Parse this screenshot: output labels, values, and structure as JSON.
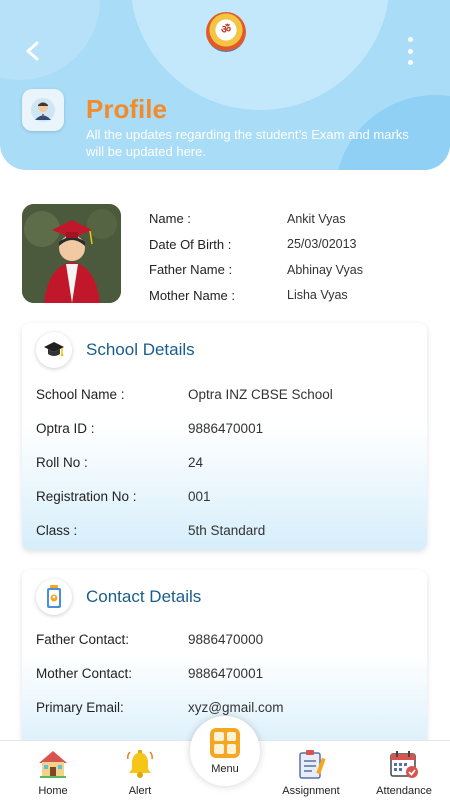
{
  "header": {
    "title": "Profile",
    "subtitle": "All the updates regarding the student’s Exam and marks will be updated here.",
    "logo_text": "ॐ",
    "back_icon": "back-arrow-icon",
    "menu_icon": "more-vertical-icon"
  },
  "student": {
    "labels": {
      "name": "Name :",
      "dob": "Date Of Birth :",
      "father": "Father Name :",
      "mother": "Mother Name :"
    },
    "values": {
      "name": "Ankit Vyas",
      "dob": "25/03/02013",
      "father": "Abhinay Vyas",
      "mother": "Lisha Vyas"
    }
  },
  "school": {
    "title": "School Details",
    "rows": [
      {
        "label": "School Name :",
        "value": "Optra INZ CBSE School"
      },
      {
        "label": "Optra ID :",
        "value": "9886470001"
      },
      {
        "label": "Roll No :",
        "value": "24"
      },
      {
        "label": "Registration No :",
        "value": "001"
      },
      {
        "label": "Class :",
        "value": "5th Standard"
      }
    ]
  },
  "contact": {
    "title": "Contact Details",
    "rows": [
      {
        "label": "Father Contact:",
        "value": "9886470000"
      },
      {
        "label": "Mother Contact:",
        "value": "9886470001"
      },
      {
        "label": "Primary Email:",
        "value": "xyz@gmail.com"
      }
    ]
  },
  "nav": {
    "home": "Home",
    "alert": "Alert",
    "menu": "Menu",
    "assignment": "Assignment",
    "attendance": "Attendance"
  },
  "colors": {
    "header_bg": "#a9dcf7",
    "title_accent": "#f28b2b",
    "card_title": "#1a5d8c",
    "menu_fab": "#f5a623"
  }
}
